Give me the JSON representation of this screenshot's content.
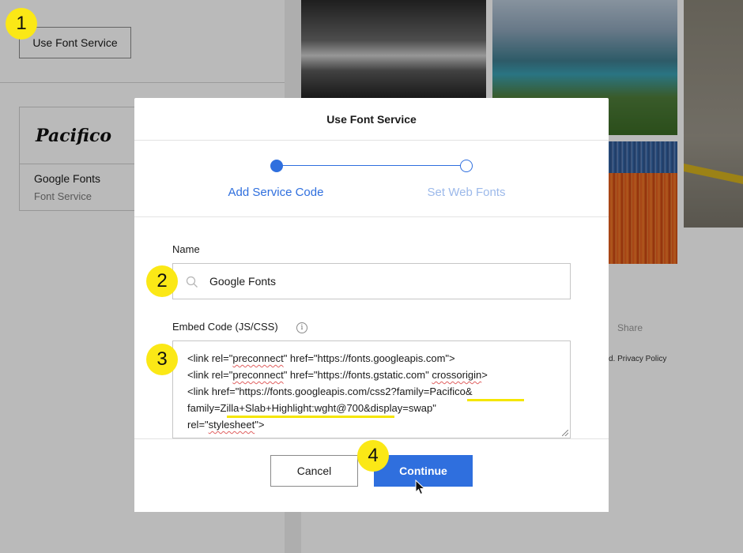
{
  "background": {
    "use_font_service_button": "Use Font Service",
    "font_card": {
      "preview_text": "Pacifico",
      "name": "Google Fonts",
      "subtitle": "Font Service"
    },
    "share_text": "Share",
    "privacy_text": "d. Privacy Policy"
  },
  "modal": {
    "title": "Use Font Service",
    "steps": [
      {
        "label": "Add Service Code",
        "state": "active"
      },
      {
        "label": "Set Web Fonts",
        "state": "inactive"
      }
    ],
    "name_field": {
      "label": "Name",
      "value": "Google Fonts",
      "icon": "search-icon"
    },
    "embed_field": {
      "label": "Embed Code (JS/CSS)",
      "info_icon": "info-icon",
      "lines": [
        "<link rel=\"preconnect\" href=\"https://fonts.googleapis.com\">",
        "<link rel=\"preconnect\" href=\"https://fonts.gstatic.com\" crossorigin>",
        "<link href=\"https://fonts.googleapis.com/css2?family=Pacifico&",
        "family=Zilla+Slab+Highlight:wght@700&display=swap\"",
        "rel=\"stylesheet\">"
      ]
    },
    "cancel_label": "Cancel",
    "continue_label": "Continue"
  },
  "callouts": [
    "1",
    "2",
    "3",
    "4"
  ],
  "colors": {
    "accent": "#2f6fde",
    "accent_light": "#9cb9ea",
    "callout": "#fbe816",
    "highlight_underline": "#f5e600",
    "spellcheck": "#e06060"
  }
}
